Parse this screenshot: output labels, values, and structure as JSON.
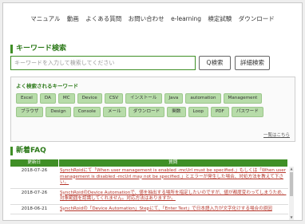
{
  "nav": {
    "items": [
      "マニュアル",
      "動画",
      "よくある質問",
      "お問い合わせ",
      "e-learning",
      "検定試験",
      "ダウンロード"
    ]
  },
  "search": {
    "title": "キーワード検索",
    "placeholder": "キーワードを入力して検索してください",
    "search_button": "Q検索",
    "detail_button": "詳細検索"
  },
  "keywords": {
    "title": "よく検索されるキーワード",
    "row1": [
      "Excel",
      "DA",
      "MC",
      "Device",
      "CSV",
      "インストール",
      "Java",
      "automation",
      "Management"
    ],
    "row2": [
      "ブラウザ",
      "Design",
      "Console",
      "メール",
      "ダウンロード",
      "関数",
      "Loop",
      "PDF",
      "パスワード"
    ],
    "more": "一覧はこちら"
  },
  "faq": {
    "title": "新着FAQ",
    "headers": {
      "date": "更新日",
      "question": "質問"
    },
    "rows": [
      {
        "date": "2018-07-26",
        "question": "SynchRoidにて「When user management is enabled -mcUrl must be specified.」もしくは「When user management is disabled -mcUrl may not be specified.」とエラーが発生した場合、対処方法を教えて下さい。"
      },
      {
        "date": "2018-07-26",
        "question": "SynchRoidのDevice Automationで、値を抽出する場所を指定したいのですが、値が都度変わってしまうため、対象範囲を認識してくれません。対応方法はありますか。"
      },
      {
        "date": "2018-06-21",
        "question": "SynchRoidの「Device Automation」Stepにて、「Enter Text」で日本語入力が文字化けする場合の原因"
      }
    ]
  }
}
